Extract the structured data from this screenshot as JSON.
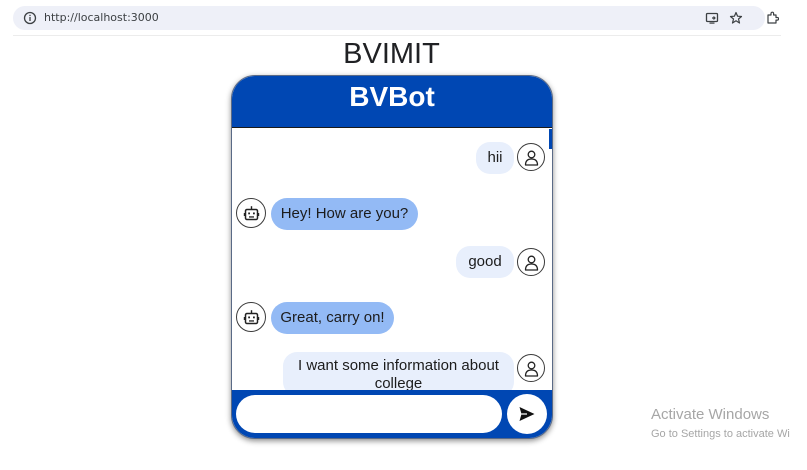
{
  "browser": {
    "url": "http://localhost:3000",
    "icons": [
      "info-icon",
      "cast-icon",
      "star-icon",
      "extensions-icon"
    ]
  },
  "page": {
    "title": "BVIMIT"
  },
  "chat": {
    "title": "BVBot",
    "messages": [
      {
        "sender": "user",
        "text": "hii"
      },
      {
        "sender": "bot",
        "text": "Hey! How are you?"
      },
      {
        "sender": "user",
        "text": "good"
      },
      {
        "sender": "bot",
        "text": "Great, carry on!"
      },
      {
        "sender": "user",
        "text": "I want some information about college"
      }
    ],
    "input": {
      "value": "",
      "placeholder": ""
    },
    "colors": {
      "primary": "#0047b3",
      "bot_bubble": "#93baf5",
      "user_bubble": "#e8effc"
    }
  },
  "os": {
    "watermark_title": "Activate Windows",
    "watermark_sub": "Go to Settings to activate Wi"
  }
}
